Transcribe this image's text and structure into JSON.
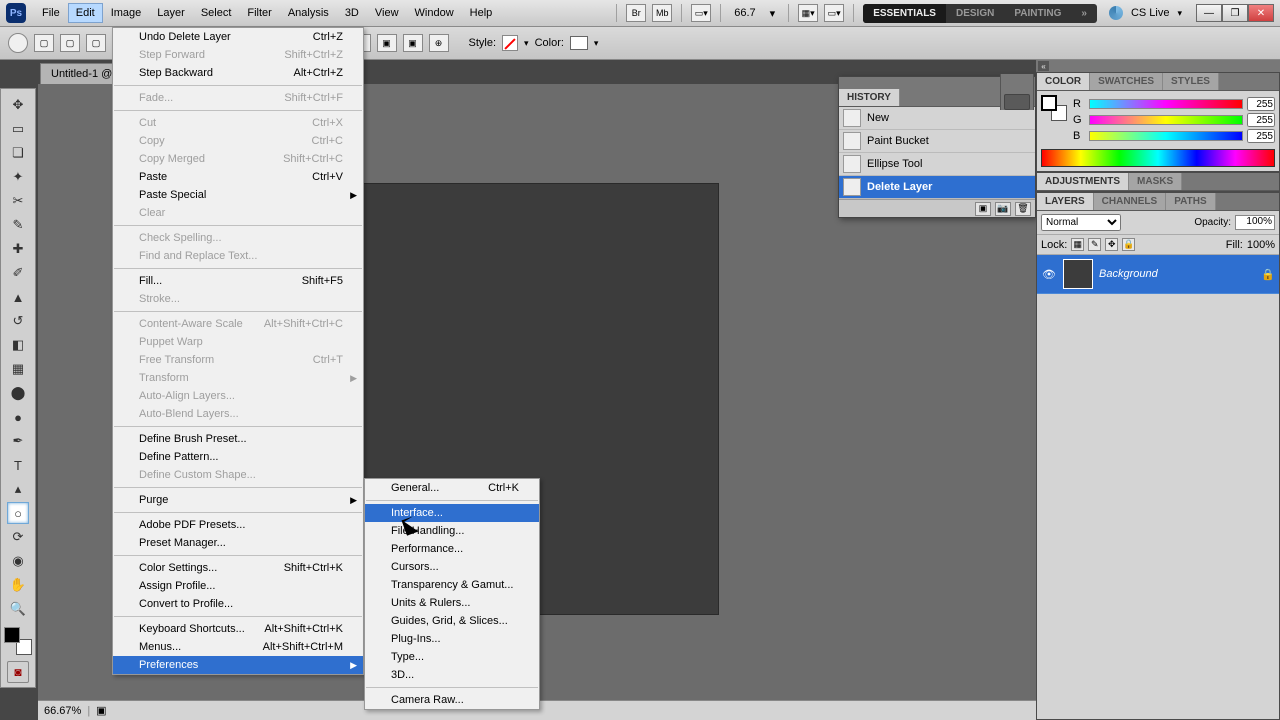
{
  "menubar": {
    "items": [
      "File",
      "Edit",
      "Image",
      "Layer",
      "Select",
      "Filter",
      "Analysis",
      "3D",
      "View",
      "Window",
      "Help"
    ],
    "open_index": 1,
    "zoom": "66.7",
    "workspaces": [
      "ESSENTIALS",
      "DESIGN",
      "PAINTING"
    ],
    "cslive": "CS Live"
  },
  "options": {
    "style_label": "Style:",
    "color_label": "Color:"
  },
  "doc_tab": "Untitled-1 @",
  "status": {
    "zoom": "66.67%"
  },
  "edit_menu": [
    {
      "label": "Undo Delete Layer",
      "shortcut": "Ctrl+Z"
    },
    {
      "label": "Step Forward",
      "shortcut": "Shift+Ctrl+Z",
      "disabled": true
    },
    {
      "label": "Step Backward",
      "shortcut": "Alt+Ctrl+Z"
    },
    {
      "sep": true
    },
    {
      "label": "Fade...",
      "shortcut": "Shift+Ctrl+F",
      "disabled": true
    },
    {
      "sep": true
    },
    {
      "label": "Cut",
      "shortcut": "Ctrl+X",
      "disabled": true
    },
    {
      "label": "Copy",
      "shortcut": "Ctrl+C",
      "disabled": true
    },
    {
      "label": "Copy Merged",
      "shortcut": "Shift+Ctrl+C",
      "disabled": true
    },
    {
      "label": "Paste",
      "shortcut": "Ctrl+V"
    },
    {
      "label": "Paste Special",
      "submenu": true
    },
    {
      "label": "Clear",
      "disabled": true
    },
    {
      "sep": true
    },
    {
      "label": "Check Spelling...",
      "disabled": true
    },
    {
      "label": "Find and Replace Text...",
      "disabled": true
    },
    {
      "sep": true
    },
    {
      "label": "Fill...",
      "shortcut": "Shift+F5"
    },
    {
      "label": "Stroke...",
      "disabled": true
    },
    {
      "sep": true
    },
    {
      "label": "Content-Aware Scale",
      "shortcut": "Alt+Shift+Ctrl+C",
      "disabled": true
    },
    {
      "label": "Puppet Warp",
      "disabled": true
    },
    {
      "label": "Free Transform",
      "shortcut": "Ctrl+T",
      "disabled": true
    },
    {
      "label": "Transform",
      "submenu": true,
      "disabled": true
    },
    {
      "label": "Auto-Align Layers...",
      "disabled": true
    },
    {
      "label": "Auto-Blend Layers...",
      "disabled": true
    },
    {
      "sep": true
    },
    {
      "label": "Define Brush Preset..."
    },
    {
      "label": "Define Pattern..."
    },
    {
      "label": "Define Custom Shape...",
      "disabled": true
    },
    {
      "sep": true
    },
    {
      "label": "Purge",
      "submenu": true
    },
    {
      "sep": true
    },
    {
      "label": "Adobe PDF Presets..."
    },
    {
      "label": "Preset Manager..."
    },
    {
      "sep": true
    },
    {
      "label": "Color Settings...",
      "shortcut": "Shift+Ctrl+K"
    },
    {
      "label": "Assign Profile..."
    },
    {
      "label": "Convert to Profile..."
    },
    {
      "sep": true
    },
    {
      "label": "Keyboard Shortcuts...",
      "shortcut": "Alt+Shift+Ctrl+K"
    },
    {
      "label": "Menus...",
      "shortcut": "Alt+Shift+Ctrl+M"
    },
    {
      "label": "Preferences",
      "submenu": true,
      "highlight": true
    }
  ],
  "prefs_submenu": [
    {
      "label": "General...",
      "shortcut": "Ctrl+K"
    },
    {
      "sep": true
    },
    {
      "label": "Interface...",
      "highlight": true
    },
    {
      "label": "File Handling..."
    },
    {
      "label": "Performance..."
    },
    {
      "label": "Cursors..."
    },
    {
      "label": "Transparency & Gamut..."
    },
    {
      "label": "Units & Rulers..."
    },
    {
      "label": "Guides, Grid, & Slices..."
    },
    {
      "label": "Plug-Ins..."
    },
    {
      "label": "Type..."
    },
    {
      "label": "3D..."
    },
    {
      "sep": true
    },
    {
      "label": "Camera Raw..."
    }
  ],
  "history": {
    "title": "HISTORY",
    "items": [
      "New",
      "Paint Bucket",
      "Ellipse Tool",
      "Delete Layer"
    ],
    "active_index": 3
  },
  "color_panel": {
    "tabs": [
      "COLOR",
      "SWATCHES",
      "STYLES"
    ],
    "r": "255",
    "g": "255",
    "b": "255"
  },
  "adjustments_tabs": [
    "ADJUSTMENTS",
    "MASKS"
  ],
  "layers_panel": {
    "tabs": [
      "LAYERS",
      "CHANNELS",
      "PATHS"
    ],
    "blend": "Normal",
    "opacity_label": "Opacity:",
    "opacity": "100%",
    "fill_label": "Fill:",
    "fill": "100%",
    "lock_label": "Lock:",
    "layer_name": "Background"
  }
}
